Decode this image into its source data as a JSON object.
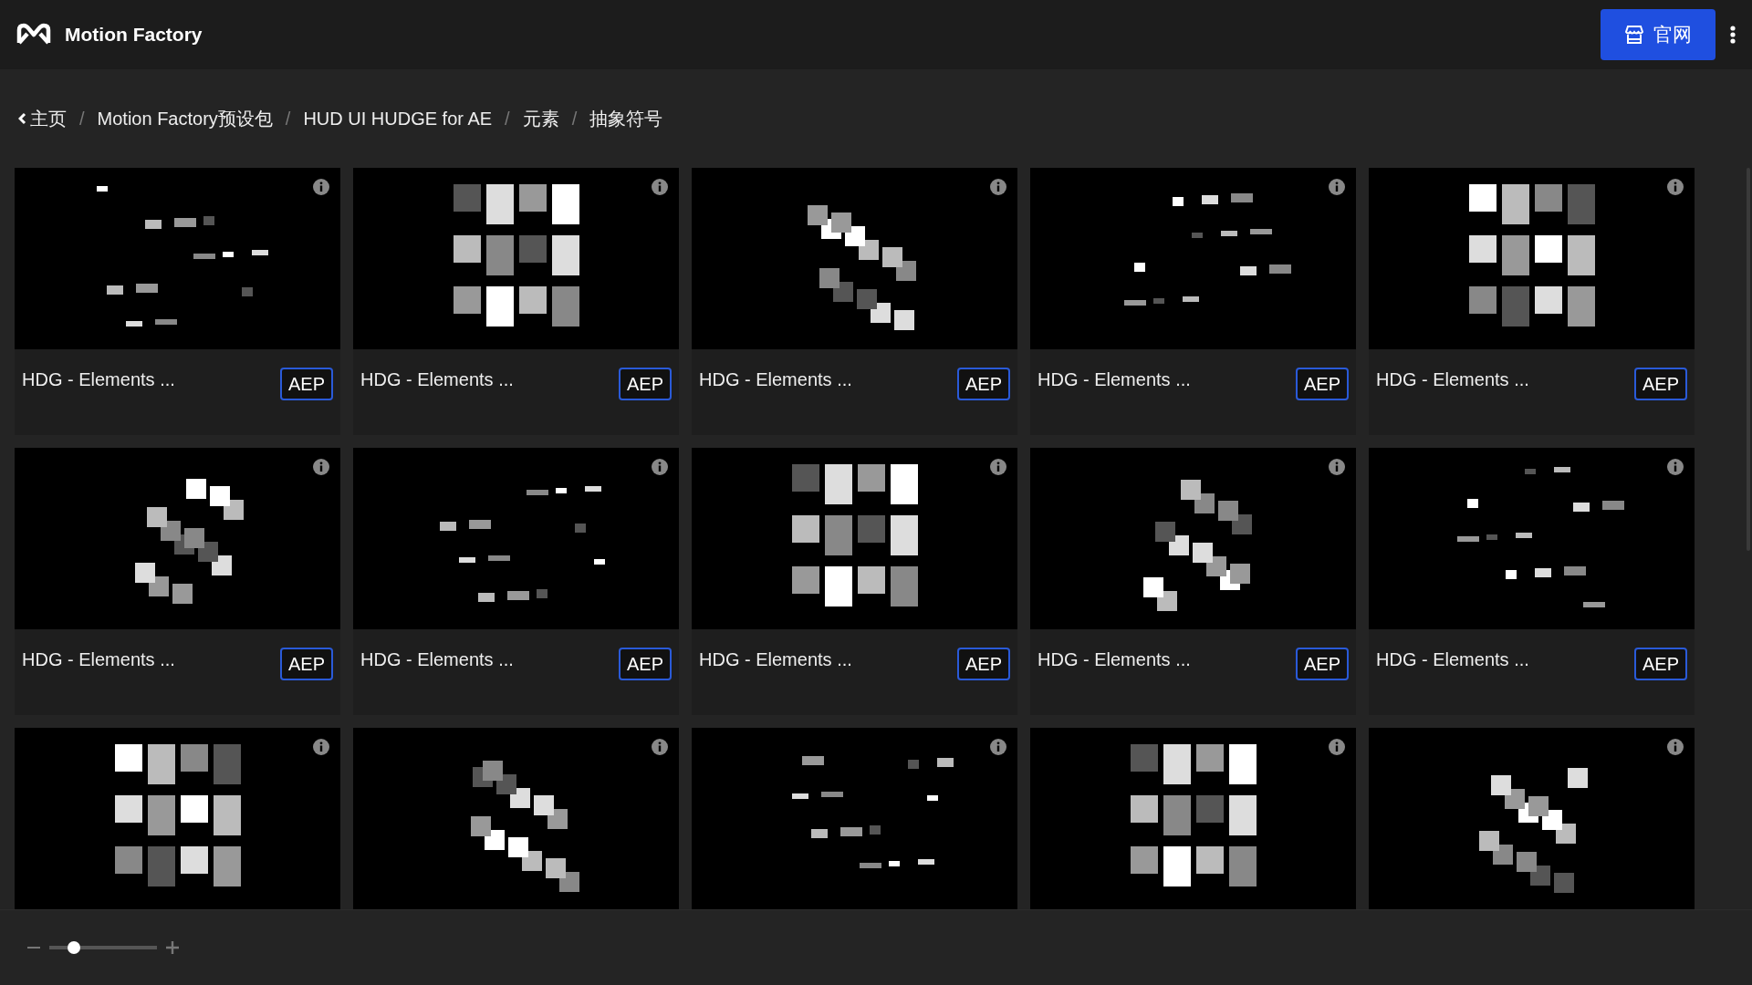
{
  "header": {
    "brand": "Motion Factory",
    "site_button": "官网"
  },
  "breadcrumb": {
    "separator": "/",
    "items": [
      "主页",
      "Motion Factory预设包",
      "HUD UI HUDGE for AE",
      "元素",
      "抽象符号"
    ]
  },
  "cards": [
    {
      "kind": "picture",
      "title": "HDG - Elements ...",
      "badge": "AEP"
    },
    {
      "kind": "picture",
      "title": "HDG - Elements ...",
      "badge": "AEP"
    },
    {
      "kind": "picture",
      "title": "HDG - Elements ...",
      "badge": "AEP"
    },
    {
      "kind": "picture",
      "title": "HDG - Elements ...",
      "badge": "AEP"
    },
    {
      "kind": "picture",
      "title": "HDG - Elements ...",
      "badge": "AEP"
    },
    {
      "kind": "picture",
      "title": "HDG - Elements ...",
      "badge": "AEP"
    },
    {
      "kind": "picture",
      "title": "HDG - Elements ...",
      "badge": "AEP"
    },
    {
      "kind": "picture",
      "title": "HDG - Elements ...",
      "badge": "AEP"
    },
    {
      "kind": "picture",
      "title": "HDG - Elements ...",
      "badge": "AEP"
    },
    {
      "kind": "picture",
      "title": "HDG - Elements ...",
      "badge": "AEP"
    },
    {
      "kind": "picture"
    },
    {
      "kind": "picture"
    },
    {
      "kind": "picture"
    },
    {
      "kind": "picture"
    },
    {
      "kind": "picture"
    }
  ],
  "zoom_slider": {
    "level": 0.23
  }
}
